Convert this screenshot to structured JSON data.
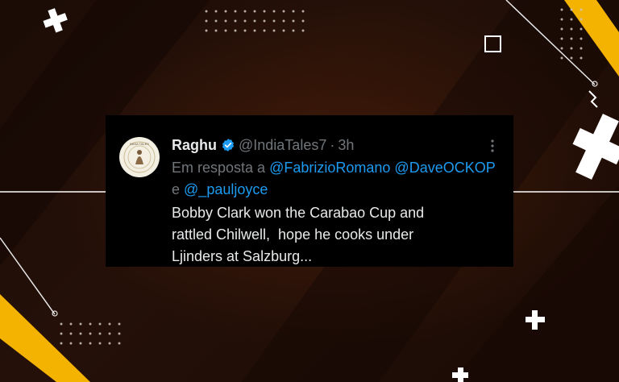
{
  "tweet": {
    "display_name": "Raghu",
    "verified": true,
    "handle": "@IndiaTales7",
    "separator": "·",
    "timestamp": "3h",
    "reply_prefix": "Em resposta a",
    "mentions": [
      "@FabrizioRomano",
      "@DaveOCKOP",
      "@_pauljoyce"
    ],
    "mention_joiner": "e",
    "text_lines": [
      "Bobby Clark won the Carabao Cup and",
      "rattled Chilwell,  hope he cooks under",
      "Ljinders at Salzburg..."
    ],
    "avatar_logo_text": "INDIA TALES"
  },
  "colors": {
    "card_bg": "#000000",
    "primary_text": "#e7e9ea",
    "secondary_text": "#71767b",
    "link": "#1d9bf0",
    "verified": "#1d9bf0",
    "accent_yellow": "#f5b301"
  },
  "icons": {
    "verified": "verified-badge-icon",
    "more": "more-options-icon"
  }
}
